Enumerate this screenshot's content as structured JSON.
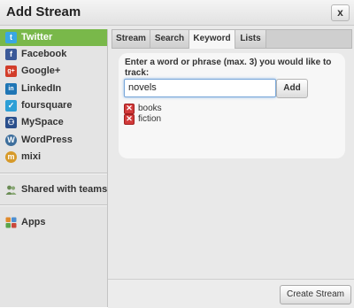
{
  "title": "Add Stream",
  "close_label": "x",
  "networks": [
    {
      "label": "Twitter",
      "icon": "twitter-icon",
      "glyph": "t",
      "color": "#3aa7e2",
      "active": true
    },
    {
      "label": "Facebook",
      "icon": "facebook-icon",
      "glyph": "f",
      "color": "#3b5998",
      "active": false
    },
    {
      "label": "Google+",
      "icon": "google-plus-icon",
      "glyph": "g+",
      "color": "#d23d2a",
      "active": false
    },
    {
      "label": "LinkedIn",
      "icon": "linkedin-icon",
      "glyph": "in",
      "color": "#1f76b5",
      "active": false
    },
    {
      "label": "foursquare",
      "icon": "foursquare-icon",
      "glyph": "✓",
      "color": "#2c9fd6",
      "active": false
    },
    {
      "label": "MySpace",
      "icon": "myspace-icon",
      "glyph": "⚇",
      "color": "#2a4f8c",
      "active": false
    },
    {
      "label": "WordPress",
      "icon": "wordpress-icon",
      "glyph": "W",
      "color": "#3d6e9c",
      "active": false
    },
    {
      "label": "mixi",
      "icon": "mixi-icon",
      "glyph": "m",
      "color": "#d79a2a",
      "active": false
    }
  ],
  "shared_teams": {
    "label": "Shared with teams",
    "icon": "teams-icon"
  },
  "apps": {
    "label": "Apps",
    "icon": "apps-icon"
  },
  "tabs": [
    {
      "label": "Stream",
      "active": false
    },
    {
      "label": "Search",
      "active": false
    },
    {
      "label": "Keyword",
      "active": true
    },
    {
      "label": "Lists",
      "active": false
    }
  ],
  "keyword": {
    "prompt": "Enter a word or phrase (max. 3) you would like to track:",
    "input_value": "novels",
    "add_label": "Add",
    "items": [
      "books",
      "fiction"
    ]
  },
  "create_label": "Create Stream"
}
